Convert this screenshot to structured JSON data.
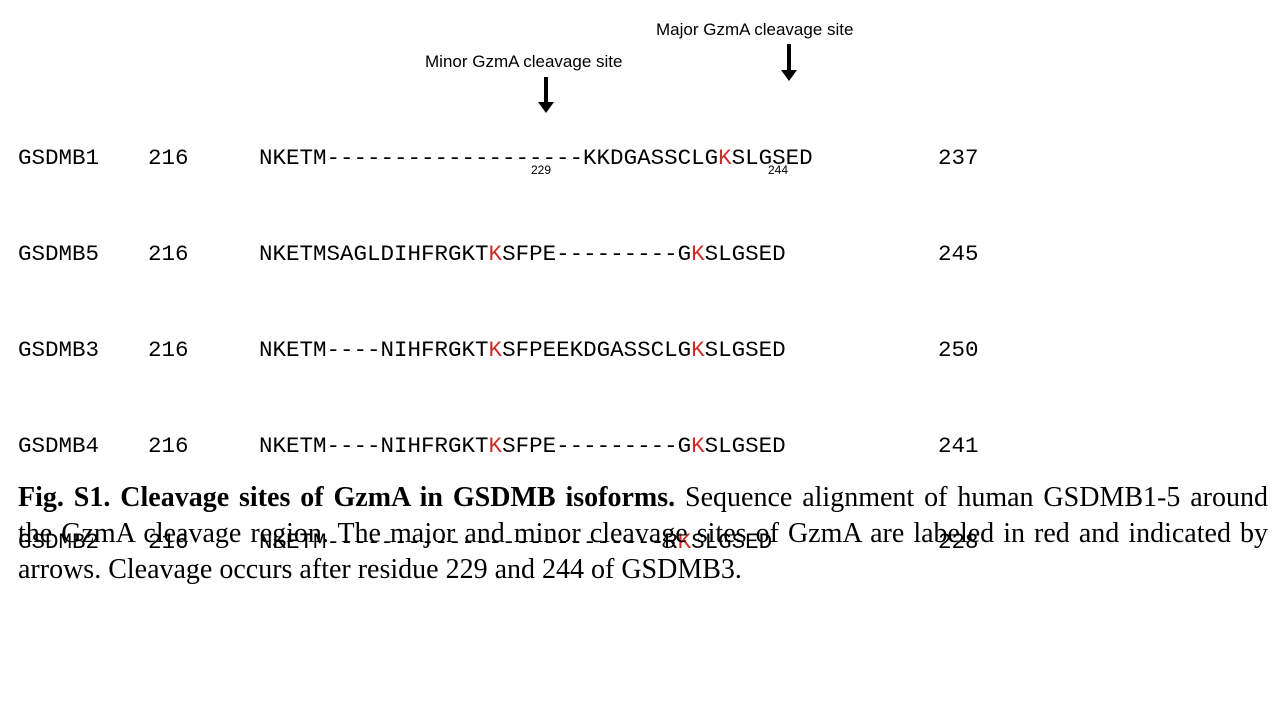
{
  "labels": {
    "major": "Major GzmA cleavage site",
    "minor": "Minor GzmA cleavage site"
  },
  "alignment": [
    {
      "name": "GSDMB1",
      "start": "216",
      "end": "237",
      "seq_a": "NKETM--------------",
      "seq_k": "",
      "seq_b": "-----KKDGASSCLG",
      "seq_k2": "K",
      "seq_c": "SLGSED"
    },
    {
      "name": "GSDMB5",
      "start": "216",
      "end": "245",
      "seq_a": "NKETMSAGLDIHFRGKT",
      "seq_k": "K",
      "seq_b": "SFPE---------G",
      "seq_k2": "K",
      "seq_c": "SLGSED"
    },
    {
      "name": "GSDMB3",
      "start": "216",
      "end": "250",
      "seq_a": "NKETM----NIHFRGKT",
      "seq_k": "K",
      "seq_b": "SFPEEKDGASSCLG",
      "seq_k2": "K",
      "seq_c": "SLGSED"
    },
    {
      "name": "GSDMB4",
      "start": "216",
      "end": "241",
      "seq_a": "NKETM----NIHFRGKT",
      "seq_k": "K",
      "seq_b": "SFPE---------G",
      "seq_k2": "K",
      "seq_c": "SLGSED"
    },
    {
      "name": "GSDMB2",
      "start": "216",
      "end": "228",
      "seq_a": "NKETM-------------------------R",
      "seq_k": "",
      "seq_b": "",
      "seq_k2": "K",
      "seq_c": "SLGSED"
    }
  ],
  "residue_labels": {
    "minor": "229",
    "major": "244"
  },
  "caption": {
    "title": "Fig. S1. Cleavage sites of GzmA in GSDMB isoforms.",
    "text": " Sequence alignment of human GSDMB1-5 around the GzmA cleavage region. The major and minor cleavage sites of GzmA are labeled in red and indicated by arrows. Cleavage occurs after residue 229 and 244 of GSDMB3."
  },
  "colors": {
    "highlight": "#c8302b"
  }
}
